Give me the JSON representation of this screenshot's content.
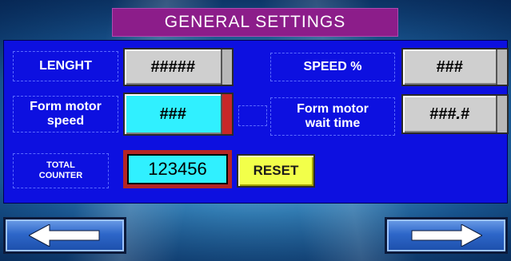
{
  "title": "GENERAL SETTINGS",
  "labels": {
    "length": "LENGHT",
    "speed_pct": "SPEED %",
    "form_motor_speed": "Form motor speed",
    "form_motor_wait": "Form motor wait time",
    "total_counter": "TOTAL COUNTER"
  },
  "values": {
    "length": "#####",
    "speed_pct": "###",
    "form_motor_speed": "###",
    "form_motor_wait": "###.#",
    "total_counter": "123456"
  },
  "buttons": {
    "reset": "RESET"
  },
  "icons": {
    "back": "arrow-left-icon",
    "next": "arrow-right-icon"
  },
  "colors": {
    "panel": "#0d10e0",
    "title": "#8c1d8a",
    "field_active": "#30f0ff",
    "reset": "#f2ff4a",
    "counter_frame": "#b52525"
  }
}
